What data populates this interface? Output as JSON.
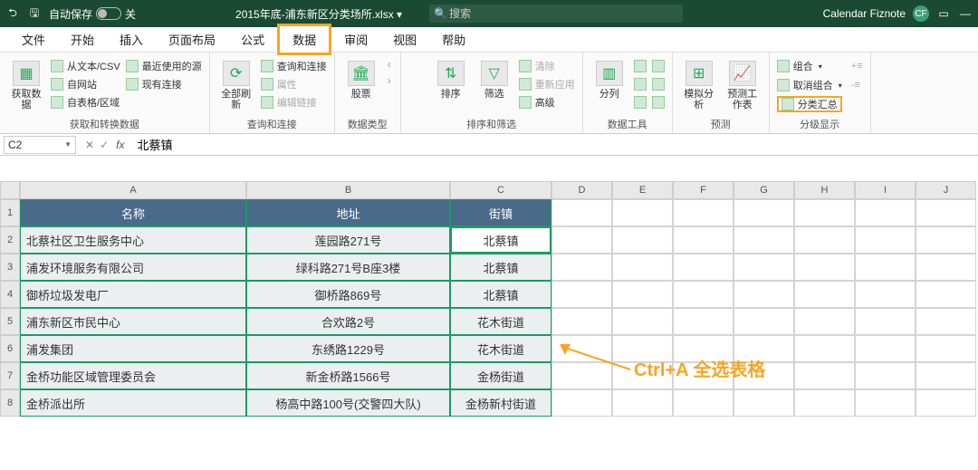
{
  "titlebar": {
    "autosave_label": "自动保存",
    "autosave_state": "关",
    "filename": "2015年底-浦东新区分类场所.xlsx ▾",
    "search_placeholder": "搜索",
    "user_name": "Calendar Fiznote",
    "user_initials": "CF"
  },
  "tabs": [
    "文件",
    "开始",
    "插入",
    "页面布局",
    "公式",
    "数据",
    "审阅",
    "视图",
    "帮助"
  ],
  "active_tab": "数据",
  "ribbon": {
    "g1": {
      "label": "获取和转换数据",
      "big": "获取数据",
      "items": [
        "从文本/CSV",
        "自网站",
        "自表格/区域",
        "最近使用的源",
        "现有连接"
      ]
    },
    "g2": {
      "label": "查询和连接",
      "big": "全部刷新",
      "items": [
        "查询和连接",
        "属性",
        "编辑链接"
      ]
    },
    "g3": {
      "label": "数据类型",
      "big": "股票"
    },
    "g4": {
      "label": "排序和筛选",
      "sort": "排序",
      "filter": "筛选",
      "items": [
        "清除",
        "重新应用",
        "高级"
      ]
    },
    "g5": {
      "label": "数据工具",
      "big": "分列"
    },
    "g6": {
      "label": "预测",
      "b1": "模拟分析",
      "b2": "预测工作表"
    },
    "g7": {
      "label": "分级显示",
      "items": [
        "组合",
        "取消组合",
        "分类汇总"
      ]
    }
  },
  "formula_bar": {
    "name_box": "C2",
    "value": "北蔡镇"
  },
  "columns": [
    "A",
    "B",
    "C",
    "D",
    "E",
    "F",
    "G",
    "H",
    "I",
    "J"
  ],
  "rows": [
    "1",
    "2",
    "3",
    "4",
    "5",
    "6",
    "7",
    "8"
  ],
  "table": {
    "headers": [
      "名称",
      "地址",
      "街镇"
    ],
    "data": [
      [
        "北蔡社区卫生服务中心",
        "莲园路271号",
        "北蔡镇"
      ],
      [
        "浦发环境服务有限公司",
        "绿科路271号B座3楼",
        "北蔡镇"
      ],
      [
        "御桥垃圾发电厂",
        "御桥路869号",
        "北蔡镇"
      ],
      [
        "浦东新区市民中心",
        "合欢路2号",
        "花木街道"
      ],
      [
        "浦发集团",
        "东绣路1229号",
        "花木街道"
      ],
      [
        "金桥功能区域管理委员会",
        "新金桥路1566号",
        "金杨街道"
      ],
      [
        "金桥派出所",
        "杨高中路100号(交警四大队)",
        "金杨新村街道"
      ]
    ]
  },
  "annotation": "Ctrl+A 全选表格"
}
